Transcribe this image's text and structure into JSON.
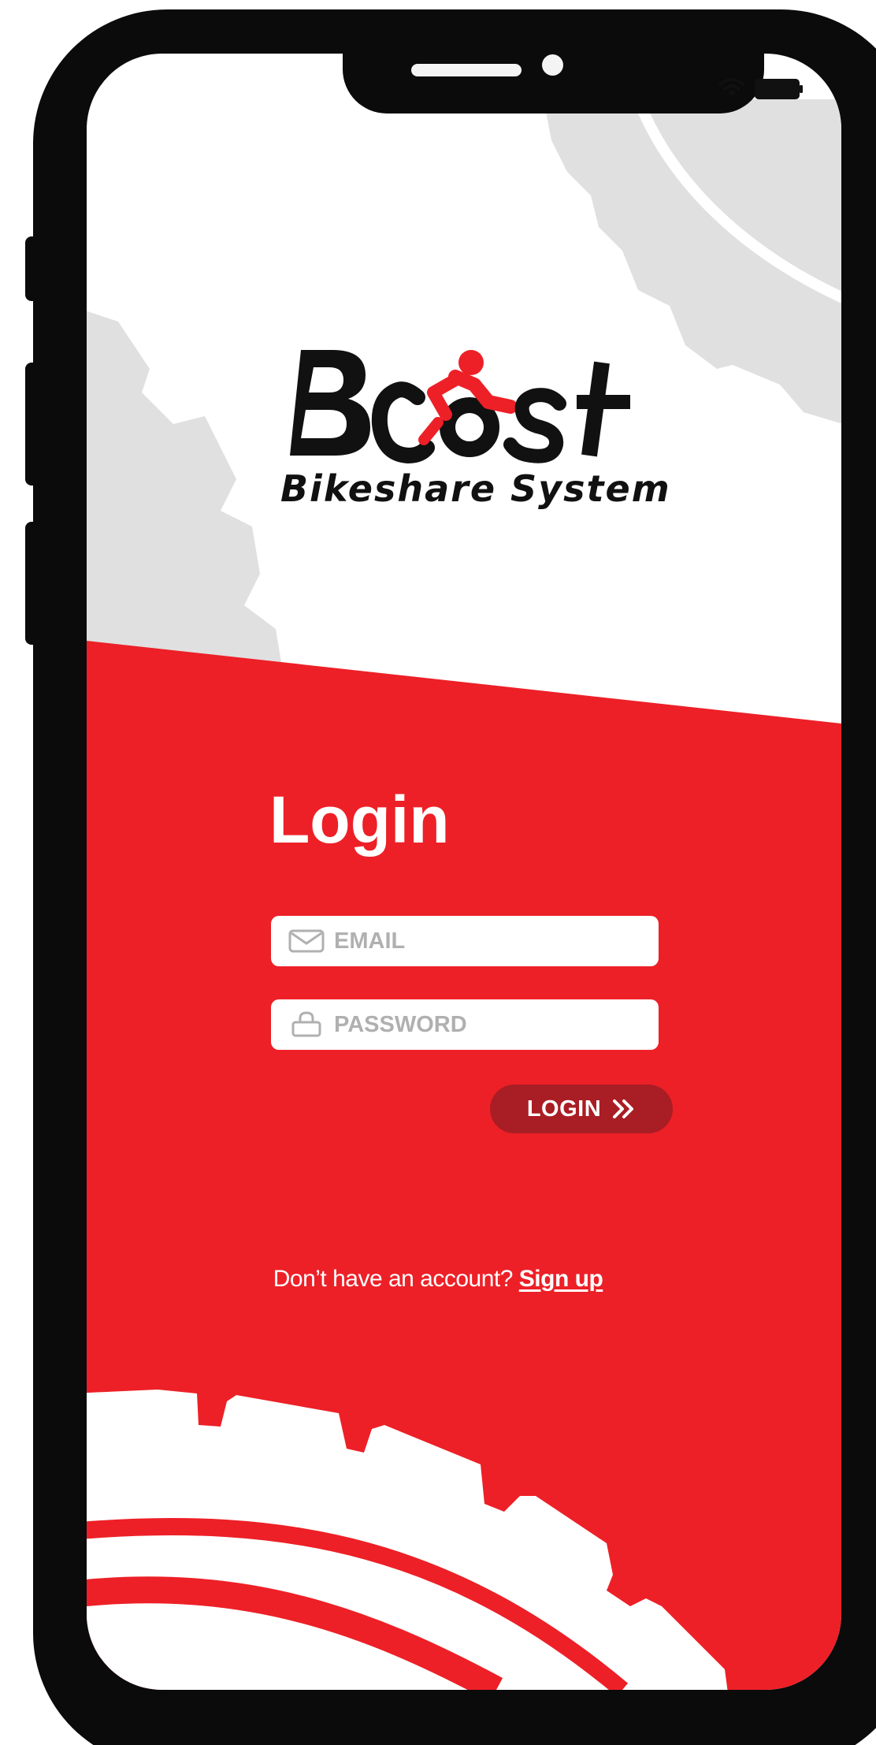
{
  "app": {
    "logo_text": "Boost",
    "tagline": "Bikeshare System"
  },
  "login": {
    "title": "Login",
    "email": {
      "placeholder": "EMAIL",
      "value": ""
    },
    "password": {
      "placeholder": "PASSWORD",
      "value": ""
    },
    "button_label": "LOGIN"
  },
  "signup": {
    "prompt": "Don’t have an account?",
    "link_label": "Sign up"
  },
  "icons": {
    "email": "envelope-icon",
    "password": "lock-icon",
    "login_button": "double-chevron-right-icon",
    "status_wifi": "wifi-icon",
    "status_battery": "battery-icon"
  },
  "colors": {
    "brand_red": "#ed2027",
    "button_dark_red": "#a91d24",
    "gear_gray": "#e0e0e0",
    "phone_frame": "#0b0b0b"
  }
}
